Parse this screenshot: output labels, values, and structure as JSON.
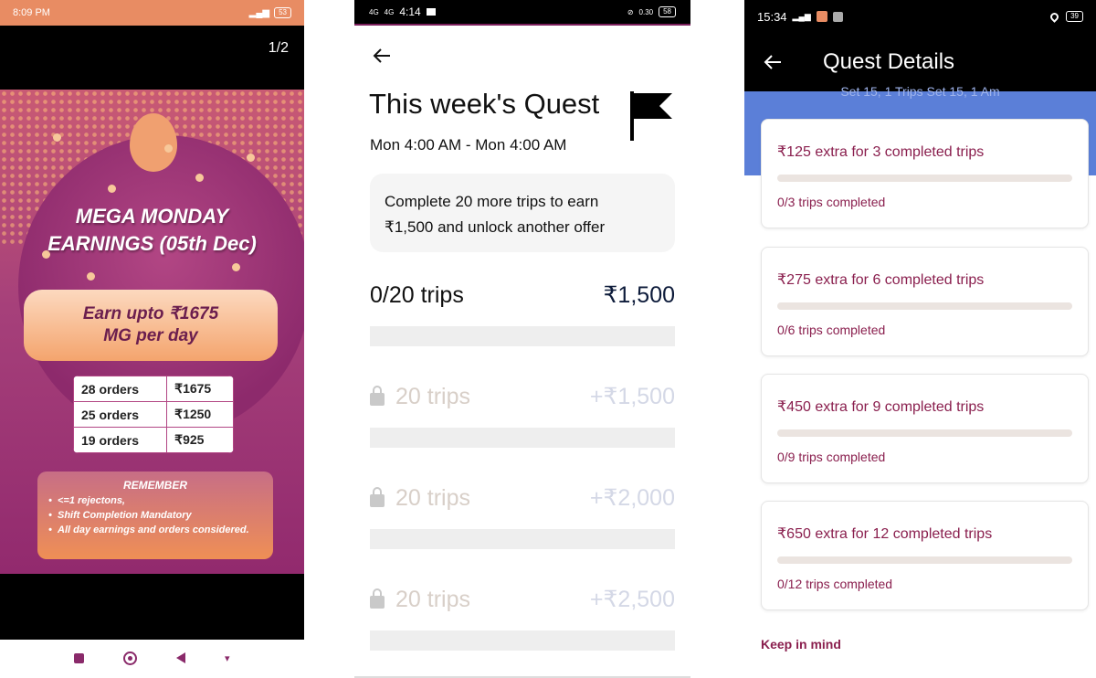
{
  "panel1": {
    "status_time": "8:09 PM",
    "status_battery": "53",
    "page_indicator": "1/2",
    "title_line1": "MEGA MONDAY",
    "title_line2": "EARNINGS (05th Dec)",
    "earn_line1": "Earn upto ₹1675",
    "earn_line2": "MG per day",
    "orders": [
      {
        "orders": "28 orders",
        "amount": "₹1675"
      },
      {
        "orders": "25 orders",
        "amount": "₹1250"
      },
      {
        "orders": "19 orders",
        "amount": "₹925"
      }
    ],
    "remember_title": "REMEMBER",
    "remember_items": [
      "<=1 rejectons,",
      "Shift Completion Mandatory",
      "All day earnings and orders considered."
    ],
    "colors": {
      "poster_top": "#c95a74",
      "poster_bottom": "#922a6e",
      "accent": "#f4a46d"
    }
  },
  "panel2": {
    "status_time": "4:14",
    "status_net": "4G",
    "status_speed": "0.30",
    "status_battery": "58",
    "title": "This week's Quest",
    "dates": "Mon 4:00 AM - Mon 4:00 AM",
    "info_line1": "Complete 20 more trips to earn",
    "info_line2": "₹1,500 and unlock another offer",
    "current": {
      "trips": "0/20 trips",
      "amount": "₹1,500"
    },
    "locked": [
      {
        "trips": "20 trips",
        "amount": "+₹1,500"
      },
      {
        "trips": "20 trips",
        "amount": "+₹2,000"
      },
      {
        "trips": "20 trips",
        "amount": "+₹2,500"
      }
    ]
  },
  "panel3": {
    "status_time": "15:34",
    "status_battery": "39",
    "appbar_title": "Quest Details",
    "band_text": "Set 15, 1 Trips Set 15, 1 Am",
    "cards": [
      {
        "title": "₹125 extra for 3 completed trips",
        "sub": "0/3 trips completed",
        "progress": 0
      },
      {
        "title": "₹275 extra for 6 completed trips",
        "sub": "0/6 trips completed",
        "progress": 0
      },
      {
        "title": "₹450 extra for 9 completed trips",
        "sub": "0/9 trips completed",
        "progress": 0
      },
      {
        "title": "₹650 extra for 12 completed trips",
        "sub": "0/12 trips completed",
        "progress": 0
      }
    ],
    "keep_in_mind": "Keep in mind",
    "colors": {
      "accent": "#8a1f4e",
      "band": "#5b7fd8"
    }
  }
}
